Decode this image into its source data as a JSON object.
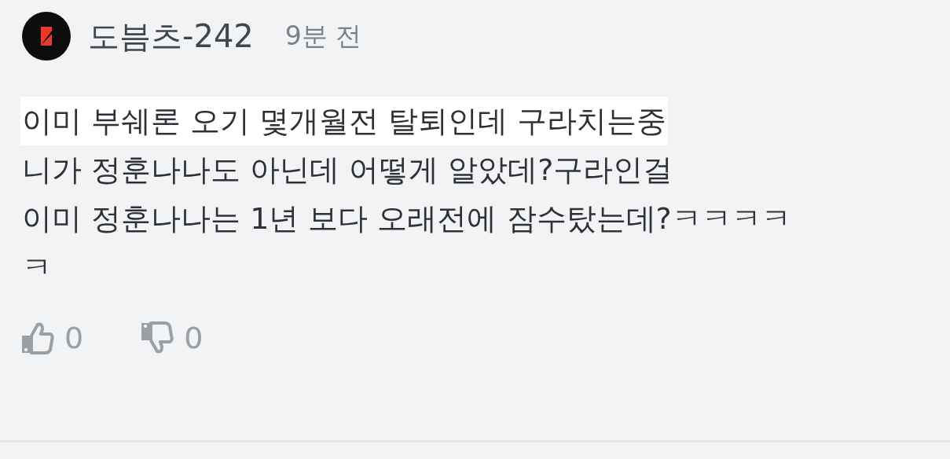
{
  "comment": {
    "author": "도븜츠-242",
    "time": "9분 전",
    "lines": [
      {
        "text": "이미 부쉐론 오기 몇개월전 탈퇴인데 구라치는중",
        "highlighted": true
      },
      {
        "text": "니가 정훈나나도 아닌데 어떻게 알았데?구라인걸",
        "highlighted": false
      },
      {
        "text": "이미 정훈나나는 1년 보다 오래전에 잠수탔는데?ㅋㅋㅋㅋ",
        "highlighted": false
      },
      {
        "text": "ㅋ",
        "highlighted": false
      }
    ],
    "likes": "0",
    "dislikes": "0"
  }
}
